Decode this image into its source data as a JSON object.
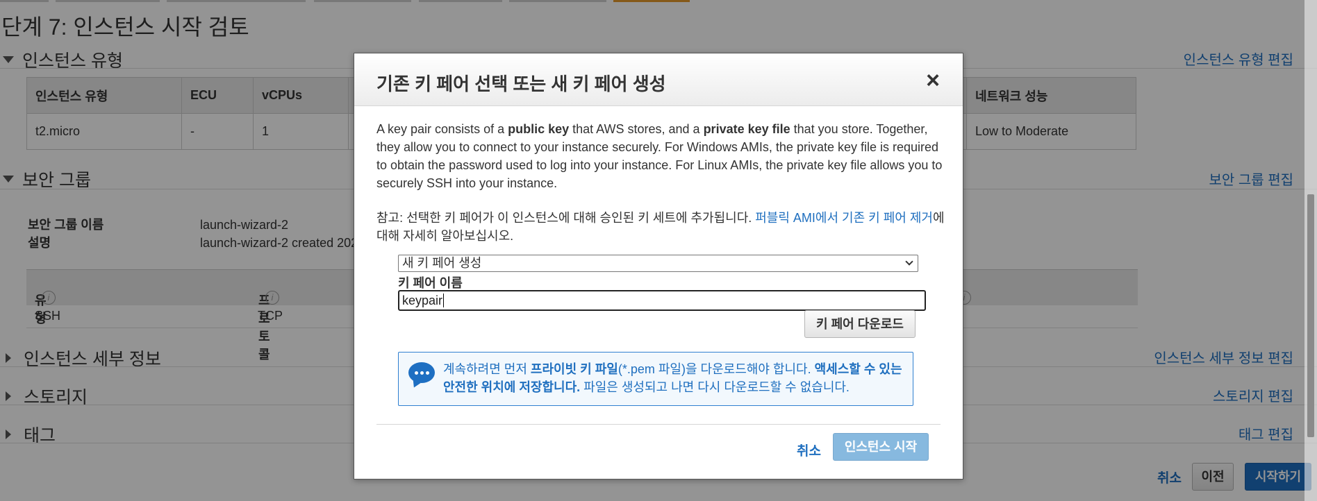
{
  "page": {
    "title": "단계 7: 인스턴스 시작 검토"
  },
  "sections": {
    "instance_type": {
      "label": "인스턴스 유형",
      "edit": "인스턴스 유형 편집"
    },
    "security_group": {
      "label": "보안 그룹",
      "edit": "보안 그룹 편집"
    },
    "instance_details": {
      "label": "인스턴스 세부 정보",
      "edit": "인스턴스 세부 정보 편집"
    },
    "storage": {
      "label": "스토리지",
      "edit": "스토리지 편집"
    },
    "tags": {
      "label": "태그",
      "edit": "태그 편집"
    }
  },
  "instance_table": {
    "headers": [
      "인스턴스 유형",
      "ECU",
      "vCPUs",
      "네트워크 성능"
    ],
    "row": [
      "t2.micro",
      "-",
      "1",
      "Low to Moderate"
    ]
  },
  "security_group_info": {
    "name_label": "보안 그룹 이름",
    "name_value": "launch-wizard-2",
    "desc_label": "설명",
    "desc_value": "launch-wizard-2 created 202"
  },
  "rules_table": {
    "headers": [
      "유형",
      "프로토콜"
    ],
    "row": [
      "SSH",
      "TCP"
    ],
    "info_icon": "i"
  },
  "footer": {
    "cancel": "취소",
    "previous": "이전",
    "launch": "시작하기"
  },
  "modal": {
    "title": "기존 키 페어 선택 또는 새 키 페어 생성",
    "close": "×",
    "description": {
      "p1": "A key pair consists of a ",
      "b1": "public key",
      "p2": " that AWS stores, and a ",
      "b2": "private key file",
      "p3": " that you store. Together, they allow you to connect to your instance securely. For Windows AMIs, the private key file is required to obtain the password used to log into your instance. For Linux AMIs, the private key file allows you to securely SSH into your instance."
    },
    "note": {
      "prefix": "참고: 선택한 키 페어가 이 인스턴스에 대해 승인된 키 세트에 추가됩니다. ",
      "link": "퍼블릭 AMI에서 기존 키 페어 제거",
      "suffix": "에 대해 자세히 알아보십시오."
    },
    "select_value": "새 키 페어 생성",
    "key_name_label": "키 페어 이름",
    "key_name_value": "keypair",
    "download_button": "키 페어 다운로드",
    "alert": {
      "t1": "계속하려면 먼저 ",
      "b1": "프라이빗 키 파일",
      "t2": "(*.pem 파일)을 다운로드해야 합니다. ",
      "b2": "액세스할 수 있는 안전한 위치에 저장합니다.",
      "t3": " 파일은 생성되고 나면 다시 다운로드할 수 없습니다."
    },
    "cancel": "취소",
    "launch": "인스턴스 시작"
  }
}
